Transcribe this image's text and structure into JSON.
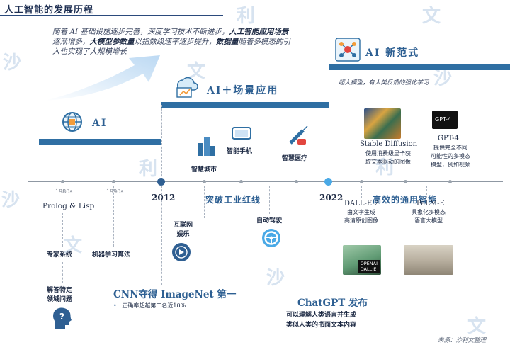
{
  "title": "人工智能的发展历程",
  "watermark": [
    "沙",
    "利",
    "文"
  ],
  "intro": {
    "p1": "随着 AI 基础设施逐步完善，深度学习技术不断进步，",
    "h1": "人工智能应用场景",
    "p2": "逐渐增多，",
    "h2": "大模型参数量",
    "p3": "以指数级速率逐步提升，",
    "h3": "数据量",
    "p4": "随着多模态的引入也实现了大规模增长"
  },
  "eras": {
    "ai": "AI",
    "scene": "AI＋场景应用",
    "new": "AI 新范式",
    "new_sub": "超大模型，有人类反馈的强化学习"
  },
  "years": {
    "y1980": "1980s",
    "y1990": "1990s",
    "y2012": "2012",
    "y2022": "2022"
  },
  "timeline_headings": {
    "industry": "突破工业红线",
    "general": "高效的通用智能"
  },
  "above": {
    "city": "智慧城市",
    "phone": "智能手机",
    "medical": "智慧医疗",
    "sd_title": "Stable Diffusion",
    "sd_desc1": "使用消费级显卡获",
    "sd_desc2": "取文本驱动的图像",
    "gpt4_title": "GPT-4",
    "gpt4_desc1": "提供完全不同",
    "gpt4_desc2": "可能性的多模态",
    "gpt4_desc3": "模型，例如视频",
    "gpt4_logo": "GPT-4"
  },
  "below": {
    "prolog": "Prolog & Lisp",
    "expert": "专家系统",
    "ml": "机器学习算法",
    "qa1": "解答特定",
    "qa2": "领域问题",
    "cnn": "CNN夺得 ImageNet 第一",
    "cnn_note": "正确率超越第二名近10%",
    "internet1": "互联网",
    "internet2": "娱乐",
    "auto": "自动驾驶",
    "chatgpt": "ChatGPT 发布",
    "chatgpt_d1": "可以理解人类语言并生成",
    "chatgpt_d2": "类似人类的书面文本内容",
    "dalle": "DALL-E 2",
    "dalle_d1": "由文字生成",
    "dalle_d2": "高清原创图像",
    "dalle_logo1": "OPENAI",
    "dalle_logo2": "DALL·E",
    "palme": "PaLM-E",
    "palme_d1": "具象化多模态",
    "palme_d2": "语言大模型"
  },
  "source": "来源：沙利文整理",
  "colors": {
    "band": "#2f6fa3",
    "accent": "#2d5f92",
    "timeline": "#8f98a3",
    "arrow": "#cfe3f5"
  }
}
